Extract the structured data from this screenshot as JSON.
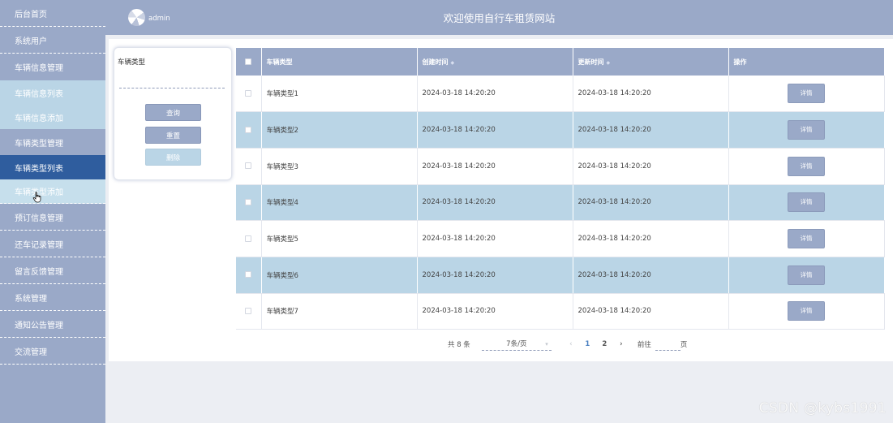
{
  "sidebar": {
    "items": [
      {
        "label": "后台首页"
      },
      {
        "label": "系统用户"
      },
      {
        "label": "车辆信息管理"
      },
      {
        "label": "车辆信息列表"
      },
      {
        "label": "车辆信息添加"
      },
      {
        "label": "车辆类型管理"
      },
      {
        "label": "车辆类型列表"
      },
      {
        "label": "车辆类型添加"
      },
      {
        "label": "预订信息管理"
      },
      {
        "label": "还车记录管理"
      },
      {
        "label": "留言反馈管理"
      },
      {
        "label": "系统管理"
      },
      {
        "label": "通知公告管理"
      },
      {
        "label": "交流管理"
      }
    ]
  },
  "header": {
    "username": "admin",
    "title": "欢迎使用自行车租赁网站"
  },
  "filter": {
    "label": "车辆类型",
    "input_value": "",
    "query_label": "查询",
    "reset_label": "重置",
    "delete_label": "删除"
  },
  "table": {
    "columns": [
      "车辆类型",
      "创建时间",
      "更新时间",
      "操作"
    ],
    "rows": [
      {
        "type": "车辆类型1",
        "created": "2024-03-18 14:20:20",
        "updated": "2024-03-18 14:20:20",
        "action": "详情"
      },
      {
        "type": "车辆类型2",
        "created": "2024-03-18 14:20:20",
        "updated": "2024-03-18 14:20:20",
        "action": "详情"
      },
      {
        "type": "车辆类型3",
        "created": "2024-03-18 14:20:20",
        "updated": "2024-03-18 14:20:20",
        "action": "详情"
      },
      {
        "type": "车辆类型4",
        "created": "2024-03-18 14:20:20",
        "updated": "2024-03-18 14:20:20",
        "action": "详情"
      },
      {
        "type": "车辆类型5",
        "created": "2024-03-18 14:20:20",
        "updated": "2024-03-18 14:20:20",
        "action": "详情"
      },
      {
        "type": "车辆类型6",
        "created": "2024-03-18 14:20:20",
        "updated": "2024-03-18 14:20:20",
        "action": "详情"
      },
      {
        "type": "车辆类型7",
        "created": "2024-03-18 14:20:20",
        "updated": "2024-03-18 14:20:20",
        "action": "详情"
      }
    ]
  },
  "pagination": {
    "total": "共 8 条",
    "page_size": "7条/页",
    "pages": [
      "1",
      "2"
    ],
    "current_page": "1",
    "goto_label": "前往",
    "goto_value": "",
    "goto_suffix": "页"
  },
  "colors": {
    "primary": "#9aa9c8",
    "accent_light": "#bad5e6",
    "active": "#2f5d9e",
    "background": "#eceef3"
  },
  "icons": {
    "prev": "chevron-left-icon",
    "next": "chevron-right-icon",
    "sort": "sort-icon",
    "dropdown": "chevron-down-icon"
  },
  "watermark": "CSDN @kybs1991"
}
